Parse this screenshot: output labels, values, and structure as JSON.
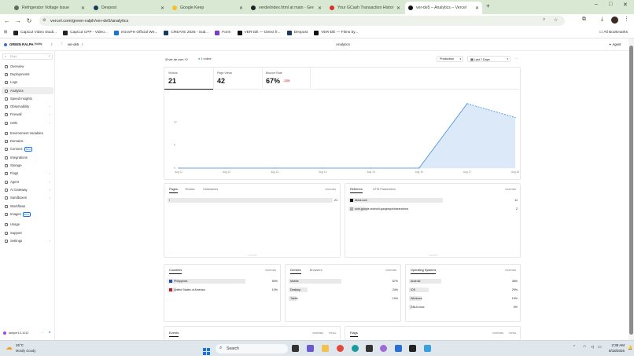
{
  "browser": {
    "tabs": [
      {
        "title": "Refrigerator Voltage Issue",
        "active": false,
        "color": "#5f6b5c"
      },
      {
        "title": "Devpost",
        "active": false,
        "color": "#1a3b5c"
      },
      {
        "title": "Google Keep",
        "active": false,
        "color": "#f6c026"
      },
      {
        "title": "verde/index.html at main · Gre",
        "active": false,
        "color": "#222222"
      },
      {
        "title": "Your GCash Transaction Histor",
        "active": false,
        "color": "#d93025"
      },
      {
        "title": "ver-de5 – Analytics – Vercel",
        "active": true,
        "color": "#111111"
      }
    ],
    "new_tab": "+",
    "url": "vercel.com/green-ralph/ver-de5/analytics",
    "bookmarks": [
      "CapCut Video Studi...",
      "CapCut CPP - Video...",
      "eGovPH Official We...",
      "CREATE 2026 - Sub...",
      "Form",
      "VER-DÉ — Direct fr...",
      "Devpost",
      "VER-DÉ — Films by..."
    ],
    "all_bookmarks": "All Bookmarks"
  },
  "header": {
    "team": "GREEN RALPH",
    "plan": "Hobby",
    "project": "ver-de5",
    "page_title": "Analytics",
    "agent": "Agent"
  },
  "sidebar": {
    "find_placeholder": "Find",
    "find_shortcut": "F",
    "items": [
      {
        "label": "Overview",
        "chevron": false,
        "beta": false
      },
      {
        "label": "Deployments",
        "chevron": false,
        "beta": false
      },
      {
        "label": "Logs",
        "chevron": false,
        "beta": false
      },
      {
        "label": "Analytics",
        "chevron": false,
        "beta": false,
        "active": true
      },
      {
        "label": "Speed Insights",
        "chevron": false,
        "beta": false
      },
      {
        "label": "Observability",
        "chevron": true,
        "beta": false
      },
      {
        "label": "Firewall",
        "chevron": true,
        "beta": false
      },
      {
        "label": "CDN",
        "chevron": true,
        "beta": false
      },
      {
        "label": "Environment Variables",
        "chevron": false,
        "beta": false
      },
      {
        "label": "Domains",
        "chevron": false,
        "beta": false
      },
      {
        "label": "Connect",
        "chevron": false,
        "beta": true
      },
      {
        "label": "Integrations",
        "chevron": false,
        "beta": false
      },
      {
        "label": "Storage",
        "chevron": false,
        "beta": false
      },
      {
        "label": "Flags",
        "chevron": true,
        "beta": false
      },
      {
        "label": "Agent",
        "chevron": true,
        "beta": false
      },
      {
        "label": "AI Gateway",
        "chevron": true,
        "beta": false
      },
      {
        "label": "Sandboxes",
        "chevron": true,
        "beta": false
      },
      {
        "label": "Workflows",
        "chevron": false,
        "beta": false
      },
      {
        "label": "Images",
        "chevron": false,
        "beta": true
      },
      {
        "label": "Usage",
        "chevron": false,
        "beta": false
      },
      {
        "label": "Support",
        "chevron": false,
        "beta": false
      },
      {
        "label": "Settings",
        "chevron": true,
        "beta": false
      }
    ],
    "beta_label": "Beta",
    "user": "lamper13-1012"
  },
  "analytics": {
    "domain": "ver-de.com",
    "domain_extra": "+2",
    "online": "1 online",
    "environment": "Production",
    "range": "Last 7 Days",
    "more": "···",
    "kpis": [
      {
        "label": "Visitors",
        "value": "21"
      },
      {
        "label": "Page Views",
        "value": "42"
      },
      {
        "label": "Bounce Rate",
        "value": "67%",
        "delta": "-33%"
      }
    ]
  },
  "chart_data": {
    "type": "area",
    "title": "",
    "xlabel": "",
    "ylabel": "",
    "x": [
      "Aug 11",
      "Aug 12",
      "Aug 13",
      "Aug 14",
      "Aug 15",
      "Aug 16",
      "Aug 17",
      "Aug 18"
    ],
    "series": [
      {
        "values": [
          0,
          0,
          0,
          0,
          0,
          0,
          14,
          11
        ]
      }
    ],
    "yticks": [
      "0",
      "5",
      "10"
    ],
    "ylim": [
      0,
      15
    ],
    "colors": {
      "fill": "#dbe9f8",
      "line": "#3a8de0"
    },
    "grid": false
  },
  "panels": {
    "pages": {
      "tabs": [
        "Pages",
        "Routes",
        "Hostnames"
      ],
      "col": "VISITORS",
      "rows": [
        {
          "label": "/",
          "value": "21",
          "fraction": 1.0
        }
      ]
    },
    "referrers": {
      "tabs": [
        "Referrers",
        "UTM Parameters"
      ],
      "col": "VISITORS",
      "rows": [
        {
          "label": "tiktok.com",
          "value": "11",
          "fraction": 1.0
        },
        {
          "label": "com.google.android.googlequicksearchbox",
          "value": "2",
          "fraction": 0.18
        }
      ]
    },
    "countries": {
      "tabs": [
        "Countries"
      ],
      "col": "VISITORS",
      "rows": [
        {
          "label": "Philippines",
          "value": "90%",
          "fraction": 0.9
        },
        {
          "label": "United States of America",
          "value": "10%",
          "fraction": 0.1
        }
      ]
    },
    "devices": {
      "tabs": [
        "Devices",
        "Browsers"
      ],
      "col": "VISITORS",
      "rows": [
        {
          "label": "Mobile",
          "value": "67%",
          "fraction": 0.67
        },
        {
          "label": "Desktop",
          "value": "24%",
          "fraction": 0.24
        },
        {
          "label": "Tablet",
          "value": "10%",
          "fraction": 0.1
        }
      ]
    },
    "os": {
      "tabs": [
        "Operating Systems"
      ],
      "col": "VISITORS",
      "rows": [
        {
          "label": "Android",
          "value": "48%",
          "fraction": 0.48
        },
        {
          "label": "iOS",
          "value": "29%",
          "fraction": 0.29
        },
        {
          "label": "Windows",
          "value": "19%",
          "fraction": 0.19
        },
        {
          "label": "GNU/Linux",
          "value": "5%",
          "fraction": 0.05
        }
      ]
    },
    "events": {
      "title": "Events",
      "cols": [
        "VISITORS",
        "TOTAL"
      ]
    },
    "flags": {
      "title": "Flags",
      "cols": [
        "VISITORS",
        "TOTAL"
      ]
    }
  },
  "taskbar": {
    "weather_temp": "26°C",
    "weather_desc": "Mostly cloudy",
    "search": "Search",
    "time": "2:38 AM",
    "date": "8/18/2026"
  }
}
